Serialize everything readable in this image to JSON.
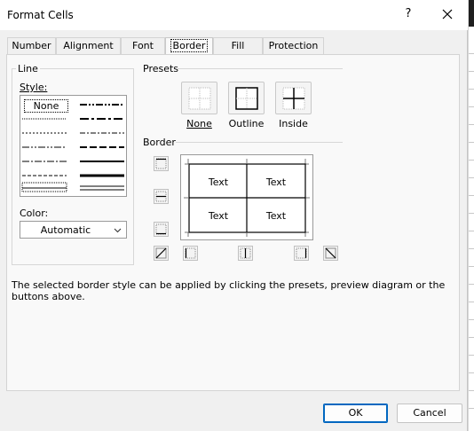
{
  "window": {
    "title": "Format Cells",
    "help_label": "?"
  },
  "tabs": [
    {
      "label": "Number"
    },
    {
      "label": "Alignment"
    },
    {
      "label": "Font"
    },
    {
      "label": "Border",
      "active": true
    },
    {
      "label": "Fill"
    },
    {
      "label": "Protection"
    }
  ],
  "line_group": {
    "title": "Line",
    "style_label": "Style:",
    "style_none": "None",
    "color_label": "Color:",
    "color_value": "Automatic"
  },
  "presets": {
    "title": "Presets",
    "none_label": "None",
    "outline_label": "Outline",
    "inside_label": "Inside"
  },
  "border": {
    "title": "Border",
    "preview_cells": [
      "Text",
      "Text",
      "Text",
      "Text"
    ]
  },
  "description": "The selected border style can be applied by clicking the presets, preview diagram or the buttons above.",
  "buttons": {
    "ok": "OK",
    "cancel": "Cancel"
  },
  "colors": {
    "accent": "#0067c0",
    "dialog_bg": "#f0f0f0",
    "panel_bg": "#f9f9f9"
  }
}
